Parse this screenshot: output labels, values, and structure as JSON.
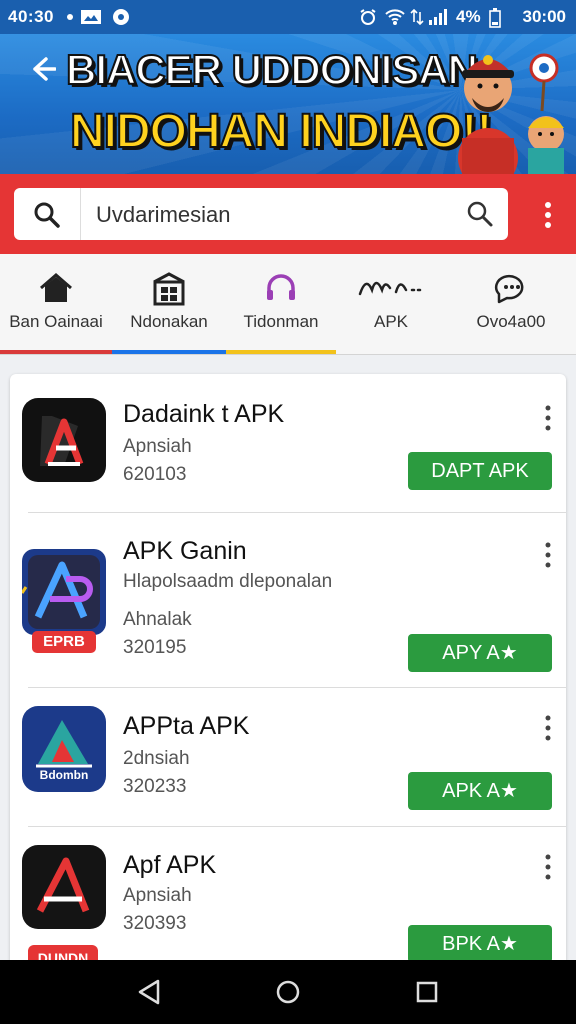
{
  "status": {
    "time_left": "40:30",
    "battery": "4%",
    "clock": "30:00"
  },
  "banner": {
    "line1": "BIACER UDDONISAN",
    "line2": "NIDOHAN INDIAO!!"
  },
  "search": {
    "value": "Uvdarimesian"
  },
  "tabs": [
    {
      "label": "Ban Oainaai",
      "icon": "home-icon",
      "accent": "#d93a3a"
    },
    {
      "label": "Ndonakan",
      "icon": "store-icon",
      "accent": "#1a73e8"
    },
    {
      "label": "Tidonman",
      "icon": "headset-icon",
      "accent": "#f2c21b"
    },
    {
      "label": "APK",
      "icon": "apk-icon",
      "accent": ""
    },
    {
      "label": "Ovo4a00",
      "icon": "chat-icon",
      "accent": ""
    }
  ],
  "apps": [
    {
      "name": "Dadaink t APK",
      "line1": "Apnsiah",
      "line2": "620103",
      "button": "DAPT APK"
    },
    {
      "name": "APK Ganin",
      "desc": "Hlapolsaadm dleponalan",
      "line1": "Ahnalak",
      "line2": "320195",
      "badge": "EPRB",
      "button": "APY A★"
    },
    {
      "name": "APPta APK",
      "line1": "2dnsiah",
      "line2": "320233",
      "icon_text": "Bdombn",
      "button": "APK A★"
    },
    {
      "name": "Apf APK",
      "line1": "Apnsiah",
      "line2": "320393",
      "badge": "DUNDN",
      "button": "BPK A★"
    }
  ],
  "colors": {
    "brand_blue": "#1c6bc4",
    "search_red": "#e53535",
    "button_green": "#2b9b3f",
    "title_yellow": "#ffd21f"
  }
}
